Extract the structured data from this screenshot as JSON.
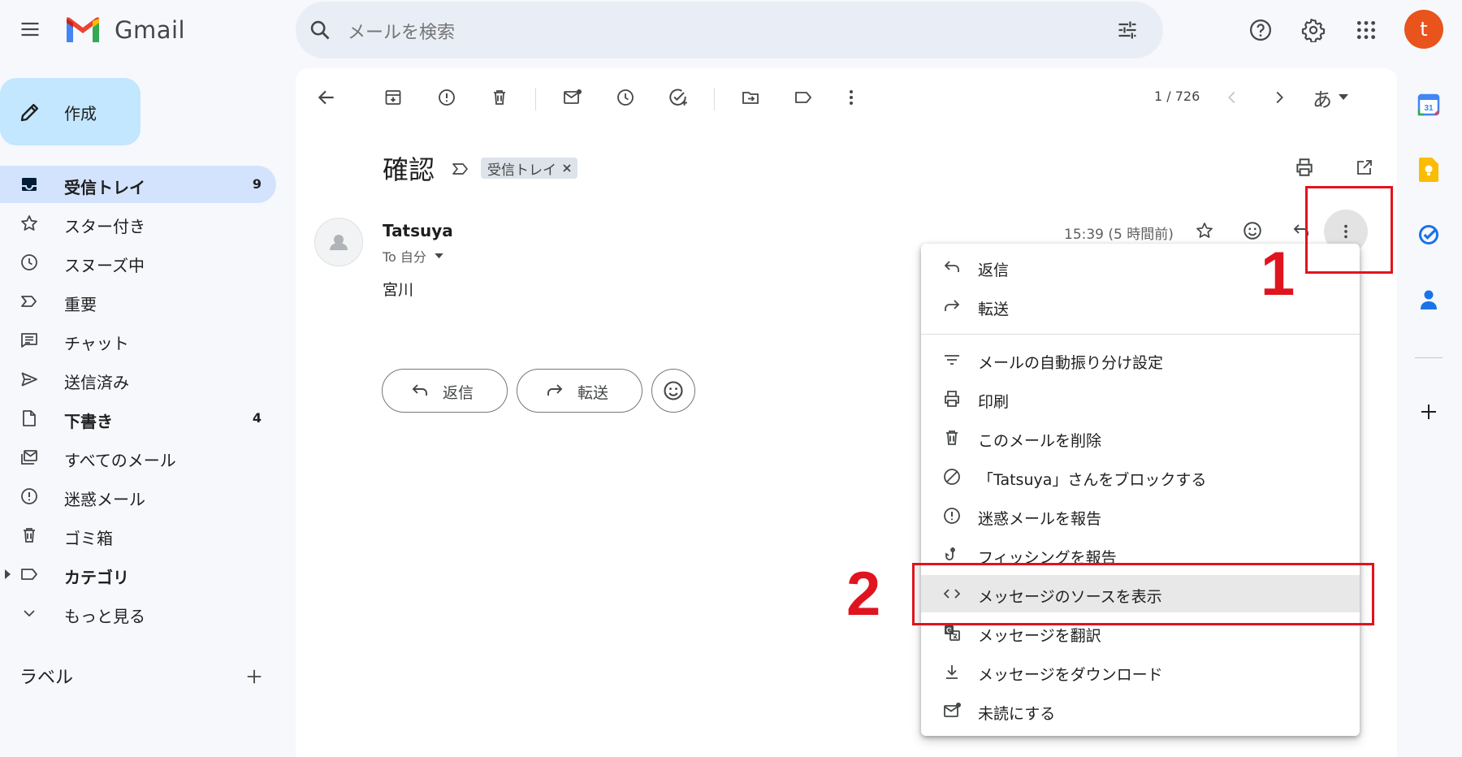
{
  "header": {
    "brand": "Gmail",
    "search_placeholder": "メールを検索",
    "avatar_letter": "t"
  },
  "compose": {
    "label": "作成"
  },
  "nav": [
    {
      "label": "受信トレイ",
      "count": "9",
      "icon": "inbox-icon",
      "active": true,
      "bold": true
    },
    {
      "label": "スター付き",
      "count": "",
      "icon": "star-icon"
    },
    {
      "label": "スヌーズ中",
      "count": "",
      "icon": "clock-icon"
    },
    {
      "label": "重要",
      "count": "",
      "icon": "important-icon"
    },
    {
      "label": "チャット",
      "count": "",
      "icon": "chat-icon"
    },
    {
      "label": "送信済み",
      "count": "",
      "icon": "send-icon"
    },
    {
      "label": "下書き",
      "count": "4",
      "icon": "draft-icon",
      "bold": true
    },
    {
      "label": "すべてのメール",
      "count": "",
      "icon": "all-mail-icon"
    },
    {
      "label": "迷惑メール",
      "count": "",
      "icon": "spam-icon"
    },
    {
      "label": "ゴミ箱",
      "count": "",
      "icon": "trash-icon"
    },
    {
      "label": "カテゴリ",
      "count": "",
      "icon": "label-icon",
      "bold": true
    },
    {
      "label": "もっと見る",
      "count": "",
      "icon": "chevron-down-icon"
    }
  ],
  "labels_section": {
    "title": "ラベル"
  },
  "toolbar": {
    "pager": "1 / 726",
    "input_tool": "あ"
  },
  "message": {
    "subject": "確認",
    "label_chip": "受信トレイ",
    "sender": "Tatsuya",
    "to": "To 自分",
    "body": "宮川",
    "timestamp": "15:39 (5 時間前)",
    "reply_label": "返信",
    "forward_label": "転送"
  },
  "menu": {
    "items": [
      {
        "label": "返信",
        "icon": "reply-icon"
      },
      {
        "label": "転送",
        "icon": "forward-icon"
      },
      {
        "label": "メールの自動振り分け設定",
        "icon": "filter-icon"
      },
      {
        "label": "印刷",
        "icon": "print-icon"
      },
      {
        "label": "このメールを削除",
        "icon": "trash-icon"
      },
      {
        "label": "「Tatsuya」さんをブロックする",
        "icon": "block-icon"
      },
      {
        "label": "迷惑メールを報告",
        "icon": "spam-icon"
      },
      {
        "label": "フィッシングを報告",
        "icon": "phishing-icon"
      },
      {
        "label": "メッセージのソースを表示",
        "icon": "code-icon",
        "highlighted": true
      },
      {
        "label": "メッセージを翻訳",
        "icon": "translate-icon"
      },
      {
        "label": "メッセージをダウンロード",
        "icon": "download-icon"
      },
      {
        "label": "未読にする",
        "icon": "mark-unread-icon"
      }
    ]
  },
  "annotations": {
    "step1": "1",
    "step2": "2",
    "color": "#e0141e"
  },
  "colors": {
    "accent": "#0b57d0",
    "compose_bg": "#c2e7ff",
    "active_nav_bg": "#d3e3fd",
    "avatar_bg": "#e8541c"
  }
}
